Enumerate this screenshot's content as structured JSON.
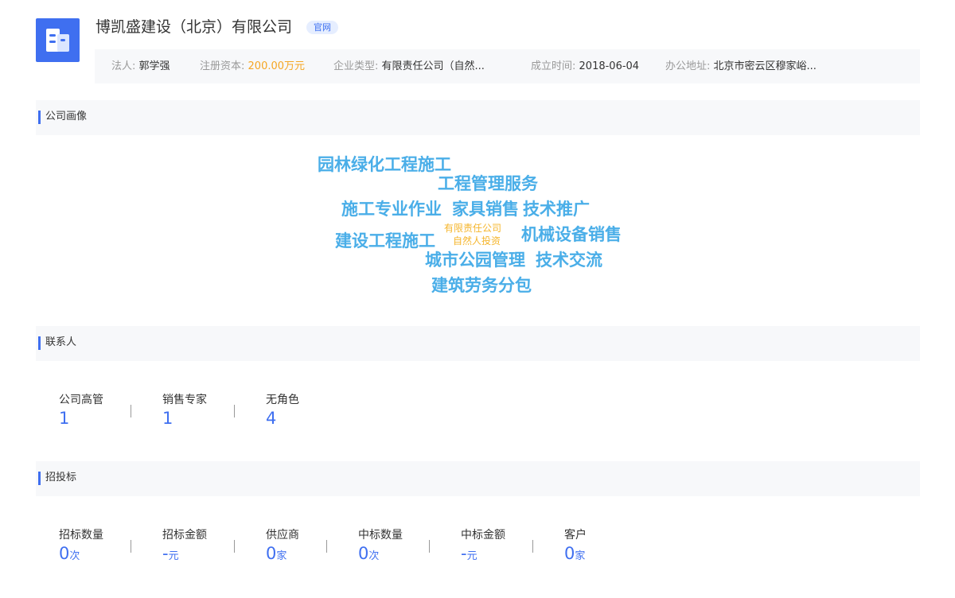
{
  "header": {
    "company_name": "博凯盛建设（北京）有限公司",
    "badge": "官网",
    "logo_icon": "building-icon",
    "colors": {
      "accent": "#3f6ff0",
      "capital": "#f5a623"
    }
  },
  "info": {
    "legal_label": "法人:",
    "legal_value": "郭学强",
    "capital_label": "注册资本:",
    "capital_value": "200.00万元",
    "type_label": "企业类型:",
    "type_value": "有限责任公司（自然...",
    "founded_label": "成立时间:",
    "founded_value": "2018-06-04",
    "address_label": "办公地址:",
    "address_value": "北京市密云区穆家峪..."
  },
  "portrait": {
    "title": "公司画像",
    "words": [
      "园林绿化工程施工",
      "工程管理服务",
      "施工专业作业",
      "家具销售",
      "技术推广",
      "建设工程施工",
      "有限责任公司",
      "自然人投资",
      "机械设备销售",
      "城市公园管理",
      "技术交流",
      "建筑劳务分包"
    ]
  },
  "contacts": {
    "title": "联系人",
    "items": [
      {
        "label": "公司高管",
        "value": "1"
      },
      {
        "label": "销售专家",
        "value": "1"
      },
      {
        "label": "无角色",
        "value": "4"
      }
    ]
  },
  "bids": {
    "title": "招投标",
    "items": [
      {
        "label": "招标数量",
        "value": "0",
        "unit": "次"
      },
      {
        "label": "招标金额",
        "value": "-",
        "unit": "元"
      },
      {
        "label": "供应商",
        "value": "0",
        "unit": "家"
      },
      {
        "label": "中标数量",
        "value": "0",
        "unit": "次"
      },
      {
        "label": "中标金额",
        "value": "-",
        "unit": "元"
      },
      {
        "label": "客户",
        "value": "0",
        "unit": "家"
      }
    ]
  }
}
